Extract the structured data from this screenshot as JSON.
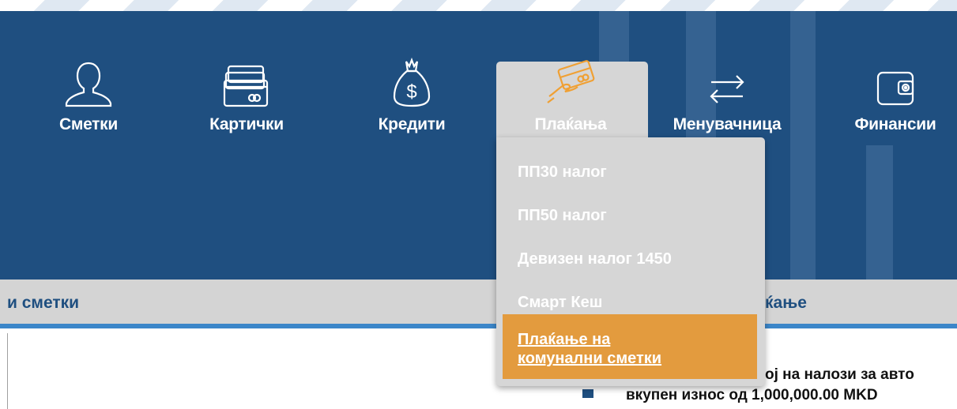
{
  "nav": {
    "items": [
      {
        "label": "Сметки",
        "icon": "user-icon"
      },
      {
        "label": "Картички",
        "icon": "cards-icon"
      },
      {
        "label": "Кредити",
        "icon": "money-bag-icon"
      },
      {
        "label": "Плаќања",
        "icon": "card-payment-icon",
        "active": true
      },
      {
        "label": "Менувачница",
        "icon": "exchange-arrows-icon"
      },
      {
        "label": "Финансии",
        "icon": "wallet-icon"
      }
    ]
  },
  "dropdown": {
    "items": [
      "ПП30 налог",
      "ПП50 налог",
      "Девизен налог 1450",
      "Смарт Кеш"
    ],
    "selected": {
      "line1": "Плаќање на",
      "line2": "комунални сметки"
    }
  },
  "header": {
    "left_title": "и сметки",
    "right_title": "ќање"
  },
  "content": {
    "line1": "ој на налози за авто",
    "line2": "вкупен износ од 1,000,000.00 MKD"
  },
  "colors": {
    "nav_background": "#1f4f80",
    "dropdown_background": "#d6d6d6",
    "selected_item": "#e39b3e",
    "accent_line": "#3b86c9"
  }
}
